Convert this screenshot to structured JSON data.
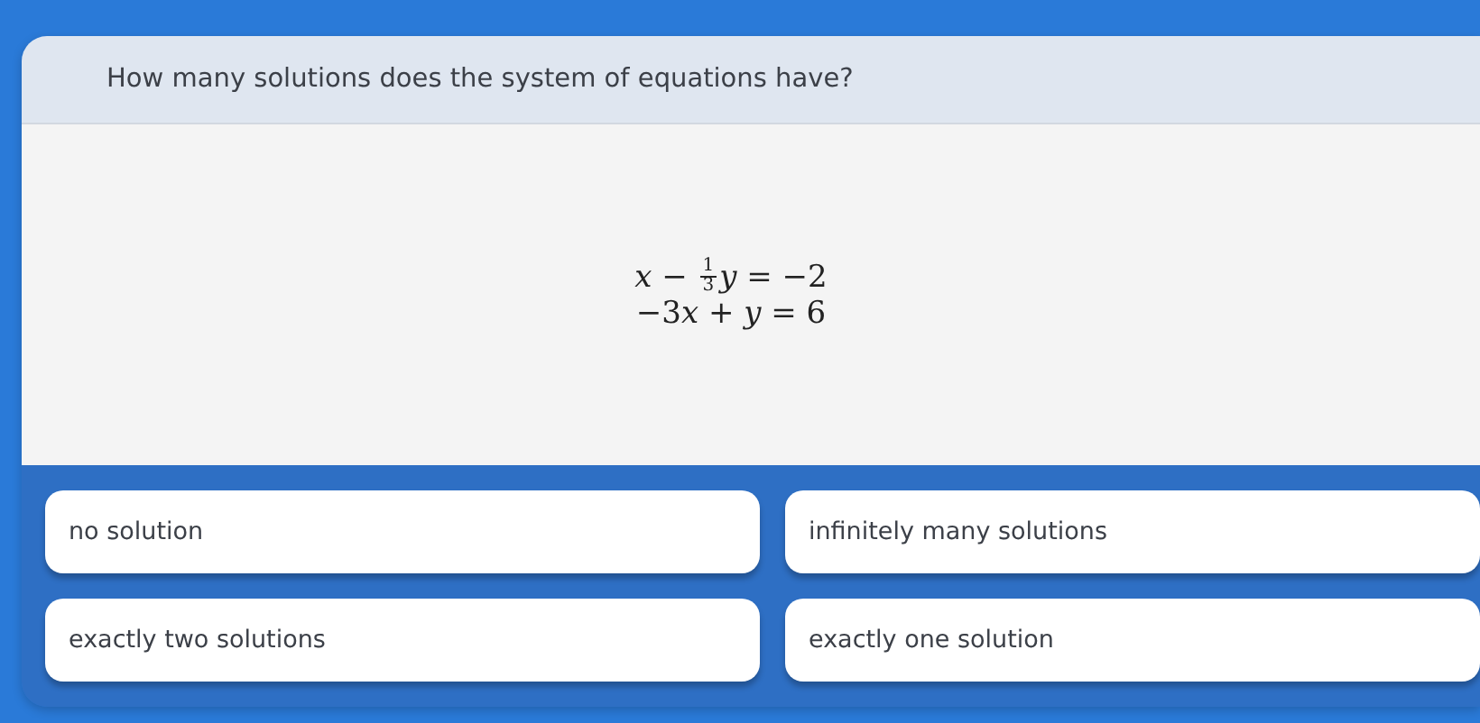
{
  "question": {
    "text": "How many solutions does the system of equations have?"
  },
  "equations": [
    {
      "parts": [
        {
          "kind": "var",
          "text": "x"
        },
        {
          "kind": "text",
          "text": " − "
        },
        {
          "kind": "fraction",
          "numerator": "1",
          "denominator": "3"
        },
        {
          "kind": "var",
          "text": "y"
        },
        {
          "kind": "text",
          "text": " = −2"
        }
      ]
    },
    {
      "parts": [
        {
          "kind": "text",
          "text": "−3"
        },
        {
          "kind": "var",
          "text": "x"
        },
        {
          "kind": "text",
          "text": " + "
        },
        {
          "kind": "var",
          "text": "y"
        },
        {
          "kind": "text",
          "text": " = 6"
        }
      ]
    }
  ],
  "answers": [
    {
      "label": "no solution"
    },
    {
      "label": "infinitely many solutions"
    },
    {
      "label": "exactly two solutions"
    },
    {
      "label": "exactly one solution"
    }
  ]
}
